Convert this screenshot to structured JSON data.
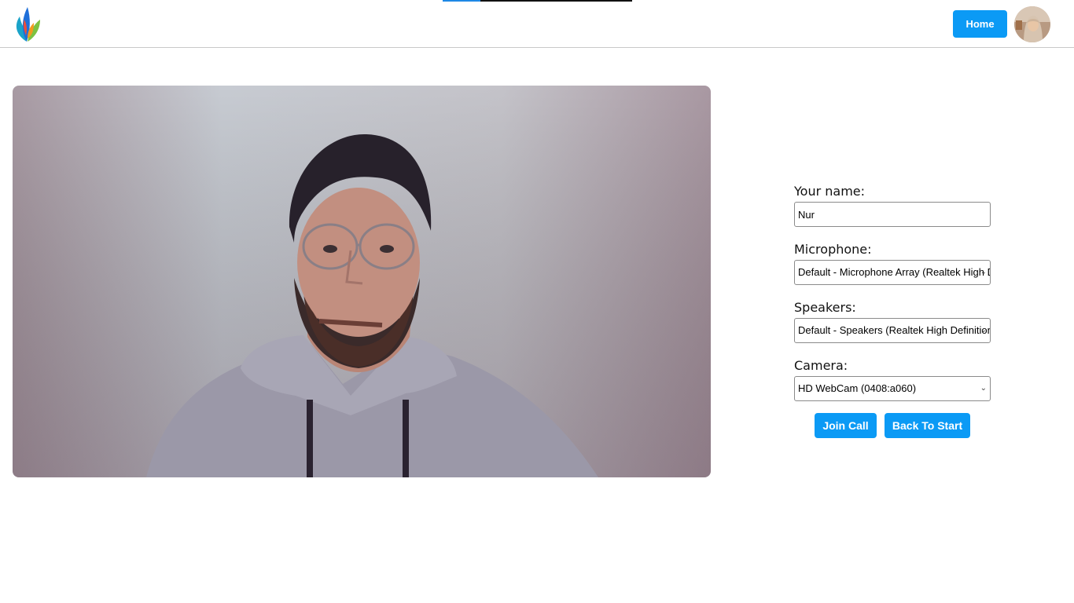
{
  "header": {
    "home_label": "Home",
    "progress_fraction": 0.2,
    "colors": {
      "accent": "#0b9af5",
      "progress_fill": "#1e88e5",
      "progress_track": "#111111"
    }
  },
  "icons": {
    "logo": "leaf-flame-logo",
    "avatar": "user-avatar"
  },
  "form": {
    "name_label": "Your name:",
    "name_value": "Nur",
    "microphone_label": "Microphone:",
    "microphone_value": "Default - Microphone Array (Realtek High Definition Audio)",
    "speakers_label": "Speakers:",
    "speakers_value": "Default - Speakers (Realtek High Definition Audio)",
    "camera_label": "Camera:",
    "camera_value": "HD WebCam (0408:a060)"
  },
  "actions": {
    "join_label": "Join Call",
    "back_label": "Back To Start"
  }
}
